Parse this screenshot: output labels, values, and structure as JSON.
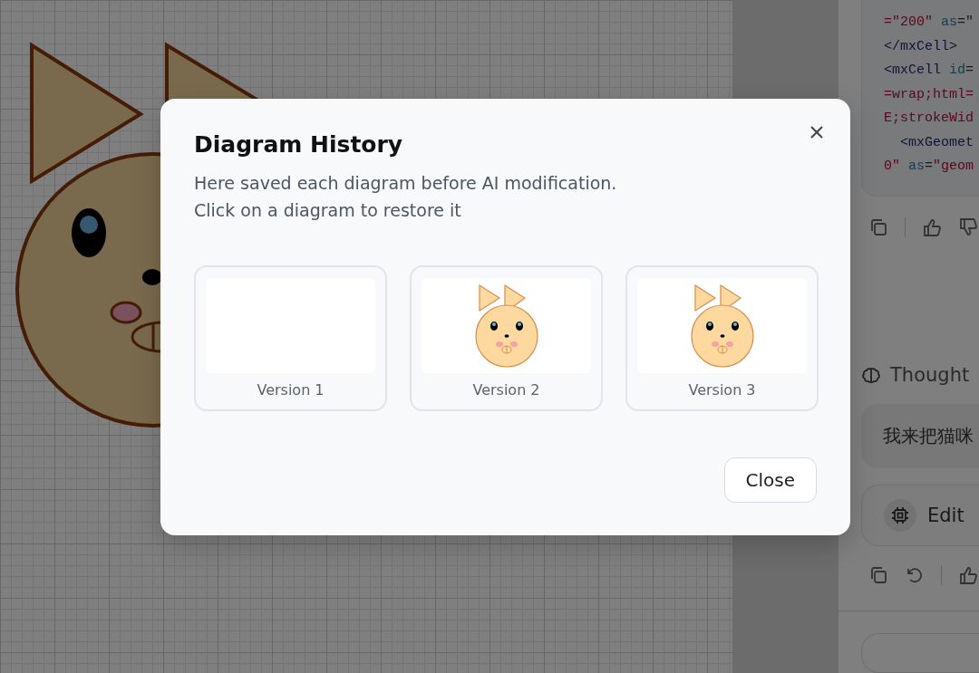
{
  "side_panel": {
    "code_lines": [
      [
        {
          "kind": "value",
          "text": "=\"200\" "
        },
        {
          "kind": "attr",
          "text": "as"
        },
        {
          "kind": "plain",
          "text": "=\""
        }
      ],
      [
        {
          "kind": "tag",
          "text": "</mxCell>"
        }
      ],
      [
        {
          "kind": "tag",
          "text": "<mxCell "
        },
        {
          "kind": "attr",
          "text": "id"
        },
        {
          "kind": "plain",
          "text": "="
        }
      ],
      [
        {
          "kind": "value",
          "text": "=wrap;html="
        }
      ],
      [
        {
          "kind": "value",
          "text": "E;strokeWid"
        }
      ],
      [
        {
          "kind": "tag",
          "text": "  <mxGeomet"
        }
      ],
      [
        {
          "kind": "value",
          "text": "0\" "
        },
        {
          "kind": "attr",
          "text": "as"
        },
        {
          "kind": "plain",
          "text": "="
        },
        {
          "kind": "value",
          "text": "\"geom"
        }
      ]
    ],
    "thought": "Thought",
    "message": "我来把猫咪",
    "tool_card": "Edit"
  },
  "dialog": {
    "title": "Diagram History",
    "description": [
      "Here saved each diagram before AI modification.",
      "Click on a diagram to restore it"
    ],
    "versions": [
      {
        "label": "Version 1",
        "kind": "empty"
      },
      {
        "label": "Version 2",
        "kind": "diagram"
      },
      {
        "label": "Version 3",
        "kind": "diagram"
      }
    ],
    "close_button": "Close"
  }
}
